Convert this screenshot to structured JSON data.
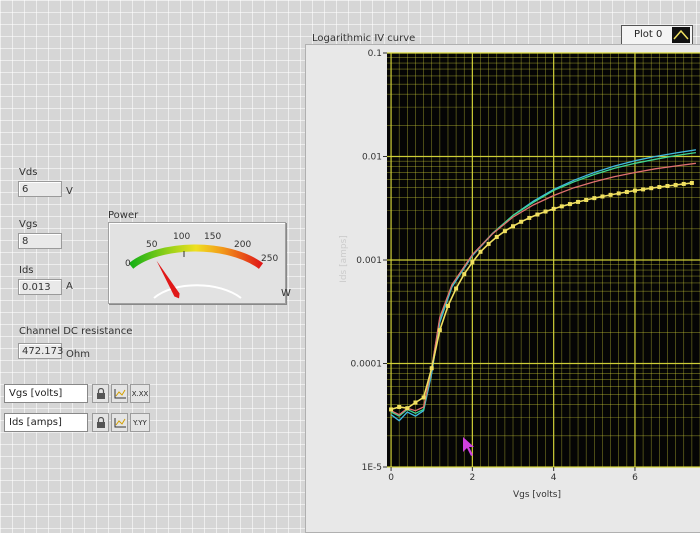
{
  "indicators": {
    "vds": {
      "label": "Vds",
      "value": "6",
      "unit": "V"
    },
    "vgs": {
      "label": "Vgs",
      "value": "8"
    },
    "ids": {
      "label": "Ids",
      "value": "0.013",
      "unit": "A"
    },
    "resistance": {
      "label": "Channel DC resistance",
      "value": "472.173",
      "unit": "Ohm"
    }
  },
  "gauge": {
    "title": "Power",
    "unit": "W",
    "scale_labels": [
      "0",
      "50",
      "100",
      "150",
      "200",
      "250"
    ],
    "needle_value": 70,
    "max": 250
  },
  "scale_controls": {
    "x": {
      "label": "Vgs [volts]",
      "format": "X.XX"
    },
    "y": {
      "label": "Ids [amps]",
      "format": "Y.YY"
    }
  },
  "graph": {
    "title": "Logarithmic IV curve",
    "legend": "Plot 0",
    "colors": {
      "grid": "#d8d83a",
      "background": "#050505",
      "markers": "#f0e060"
    }
  },
  "chart_data": {
    "type": "line",
    "title": "Logarithmic IV curve",
    "xlabel": "Vgs [volts]",
    "ylabel": "Ids [amps]",
    "xlim": [
      -0.1,
      7.6
    ],
    "ylim": [
      1e-05,
      0.1
    ],
    "yscale": "log",
    "x_ticks": [
      "0",
      "2",
      "4",
      "6"
    ],
    "y_ticks": [
      "0.1",
      "0.01",
      "0.001",
      "0.0001",
      "1E-5"
    ],
    "grid": true,
    "series": [
      {
        "color": "#3fb8e0",
        "x": [
          0,
          0.2,
          0.4,
          0.6,
          0.8,
          1.0,
          1.2,
          1.5,
          2.0,
          2.5,
          3.0,
          3.5,
          4.0,
          4.5,
          5.0,
          5.5,
          6.0,
          6.5,
          7.0,
          7.5
        ],
        "y": [
          3.2e-05,
          2.8e-05,
          3.4e-05,
          3.1e-05,
          3.5e-05,
          8e-05,
          0.00025,
          0.00055,
          0.0011,
          0.0018,
          0.0027,
          0.0037,
          0.0048,
          0.0059,
          0.007,
          0.0081,
          0.0091,
          0.01,
          0.0108,
          0.0116
        ]
      },
      {
        "color": "#40d890",
        "x": [
          0,
          0.2,
          0.4,
          0.6,
          0.8,
          1.0,
          1.2,
          1.5,
          2.0,
          2.5,
          3.0,
          3.5,
          4.0,
          4.5,
          5.0,
          5.5,
          6.0,
          6.5,
          7.0,
          7.5
        ],
        "y": [
          3.4e-05,
          3.1e-05,
          3.6e-05,
          3.3e-05,
          3.6e-05,
          9e-05,
          0.00027,
          0.00057,
          0.00112,
          0.00182,
          0.0027,
          0.0036,
          0.0047,
          0.0057,
          0.0067,
          0.0077,
          0.0086,
          0.0094,
          0.0102,
          0.0109
        ]
      },
      {
        "color": "#e07070",
        "x": [
          0,
          0.2,
          0.4,
          0.6,
          0.8,
          1.0,
          1.2,
          1.5,
          2.0,
          2.5,
          3.0,
          3.5,
          4.0,
          4.5,
          5.0,
          5.5,
          6.0,
          6.5,
          7.0,
          7.5
        ],
        "y": [
          3.5e-05,
          3.2e-05,
          3.7e-05,
          3.5e-05,
          3.8e-05,
          9e-05,
          0.00028,
          0.00058,
          0.00113,
          0.0018,
          0.0026,
          0.0034,
          0.0042,
          0.005,
          0.0057,
          0.0064,
          0.007,
          0.0076,
          0.0081,
          0.0086
        ]
      },
      {
        "color": "#f0e060",
        "markers": true,
        "x": [
          0,
          0.2,
          0.4,
          0.6,
          0.8,
          1.0,
          1.2,
          1.4,
          1.6,
          1.8,
          2.0,
          2.2,
          2.4,
          2.6,
          2.8,
          3.0,
          3.2,
          3.4,
          3.6,
          3.8,
          4.0,
          4.2,
          4.4,
          4.6,
          4.8,
          5.0,
          5.2,
          5.4,
          5.6,
          5.8,
          6.0,
          6.2,
          6.4,
          6.6,
          6.8,
          7.0,
          7.2,
          7.4
        ],
        "y": [
          3.6e-05,
          3.8e-05,
          3.7e-05,
          4.2e-05,
          4.7e-05,
          9e-05,
          0.00021,
          0.00036,
          0.00053,
          0.00073,
          0.00095,
          0.0012,
          0.00143,
          0.00167,
          0.0019,
          0.00212,
          0.00234,
          0.00255,
          0.00275,
          0.00294,
          0.00312,
          0.0033,
          0.00347,
          0.00364,
          0.0038,
          0.00396,
          0.00411,
          0.00426,
          0.0044,
          0.00454,
          0.00468,
          0.00481,
          0.00494,
          0.00507,
          0.00519,
          0.00531,
          0.00543,
          0.00555
        ]
      }
    ]
  }
}
